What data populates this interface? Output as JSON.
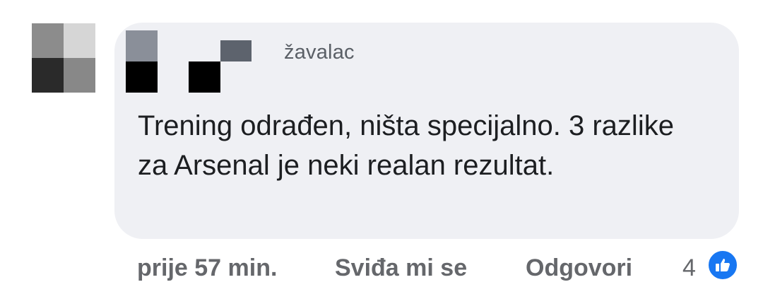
{
  "comment": {
    "author": "žavalac",
    "text": "Trening odrađen, ništa specijalno. 3 razlike za Arsenal je neki realan rezultat."
  },
  "actions": {
    "time": "prije 57 min.",
    "like_label": "Sviđa mi se",
    "reply_label": "Odgovori",
    "reaction_count": "4"
  },
  "icons": {
    "reaction": "like-thumbs-up-icon"
  },
  "colors": {
    "bubble": "#eff0f4",
    "like_blue": "#1877f2",
    "secondary_text": "#65676b",
    "primary_text": "#1c1e21"
  }
}
